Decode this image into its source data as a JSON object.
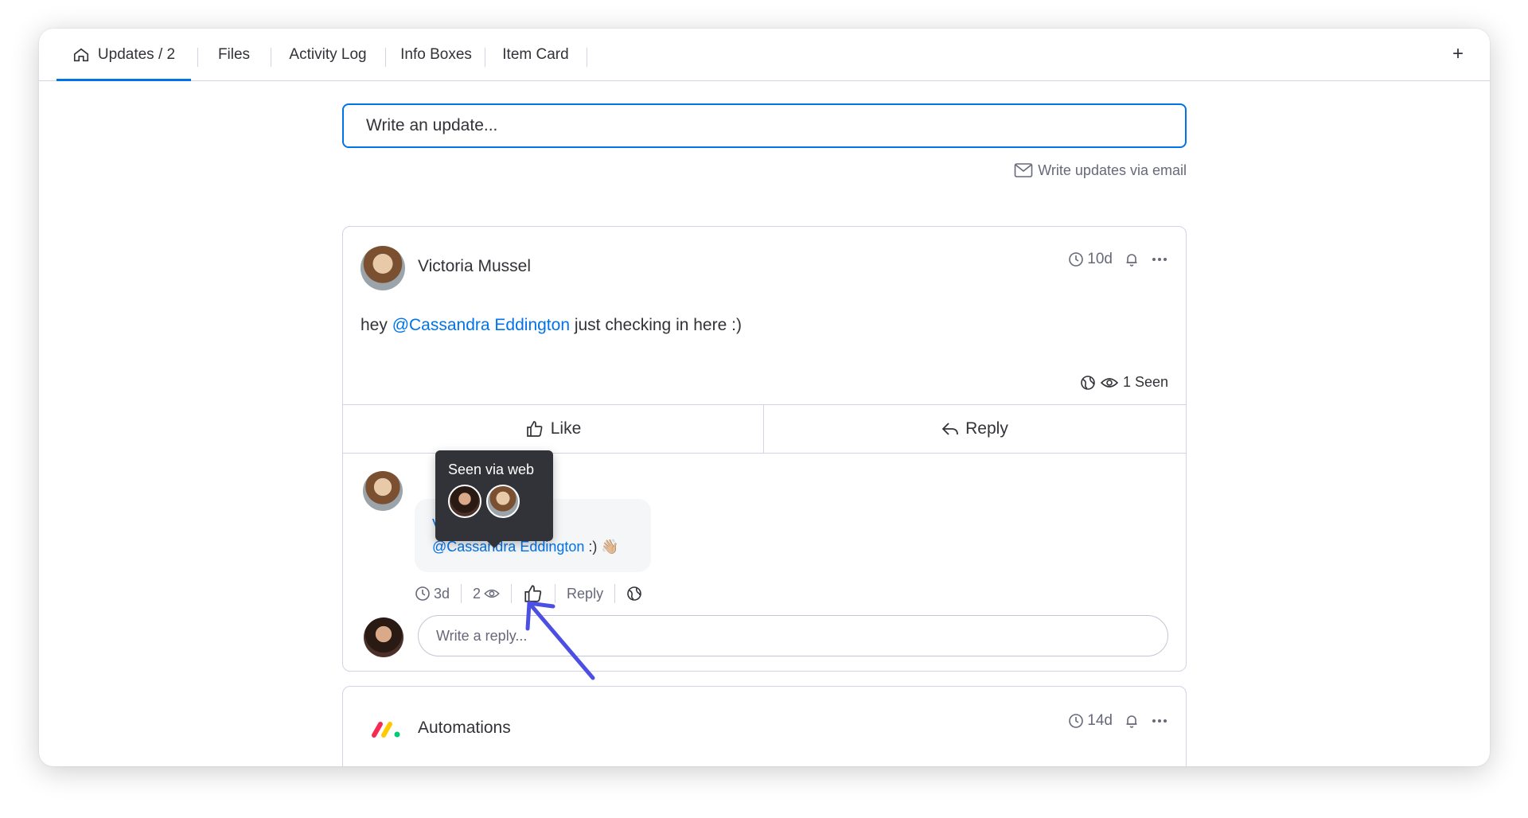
{
  "tabs": [
    {
      "label": "Updates / 2",
      "active": true
    },
    {
      "label": "Files"
    },
    {
      "label": "Activity Log"
    },
    {
      "label": "Info Boxes"
    },
    {
      "label": "Item Card"
    }
  ],
  "add_tab_label": "+",
  "composer": {
    "placeholder": "Write an update..."
  },
  "email_link": "Write updates via email",
  "post": {
    "author": "Victoria Mussel",
    "time": "10d",
    "body_prefix": "hey ",
    "mention": "@Cassandra Eddington",
    "body_suffix": " just checking in here :)",
    "seen": "1 Seen",
    "like_label": "Like",
    "reply_label": "Reply",
    "reply": {
      "author": "Victoria Mussel",
      "mention": "@Cassandra Eddington",
      "text": " :) 👋🏼",
      "time": "3d",
      "seen_count": "2",
      "reply_label": "Reply"
    },
    "reply_placeholder": "Write a reply..."
  },
  "tooltip": {
    "title": "Seen via web"
  },
  "automations": {
    "author": "Automations",
    "time": "14d"
  },
  "colors": {
    "accent": "#0073ea",
    "annotation_arrow": "#4b4fe4",
    "tooltip_bg": "#323338"
  }
}
